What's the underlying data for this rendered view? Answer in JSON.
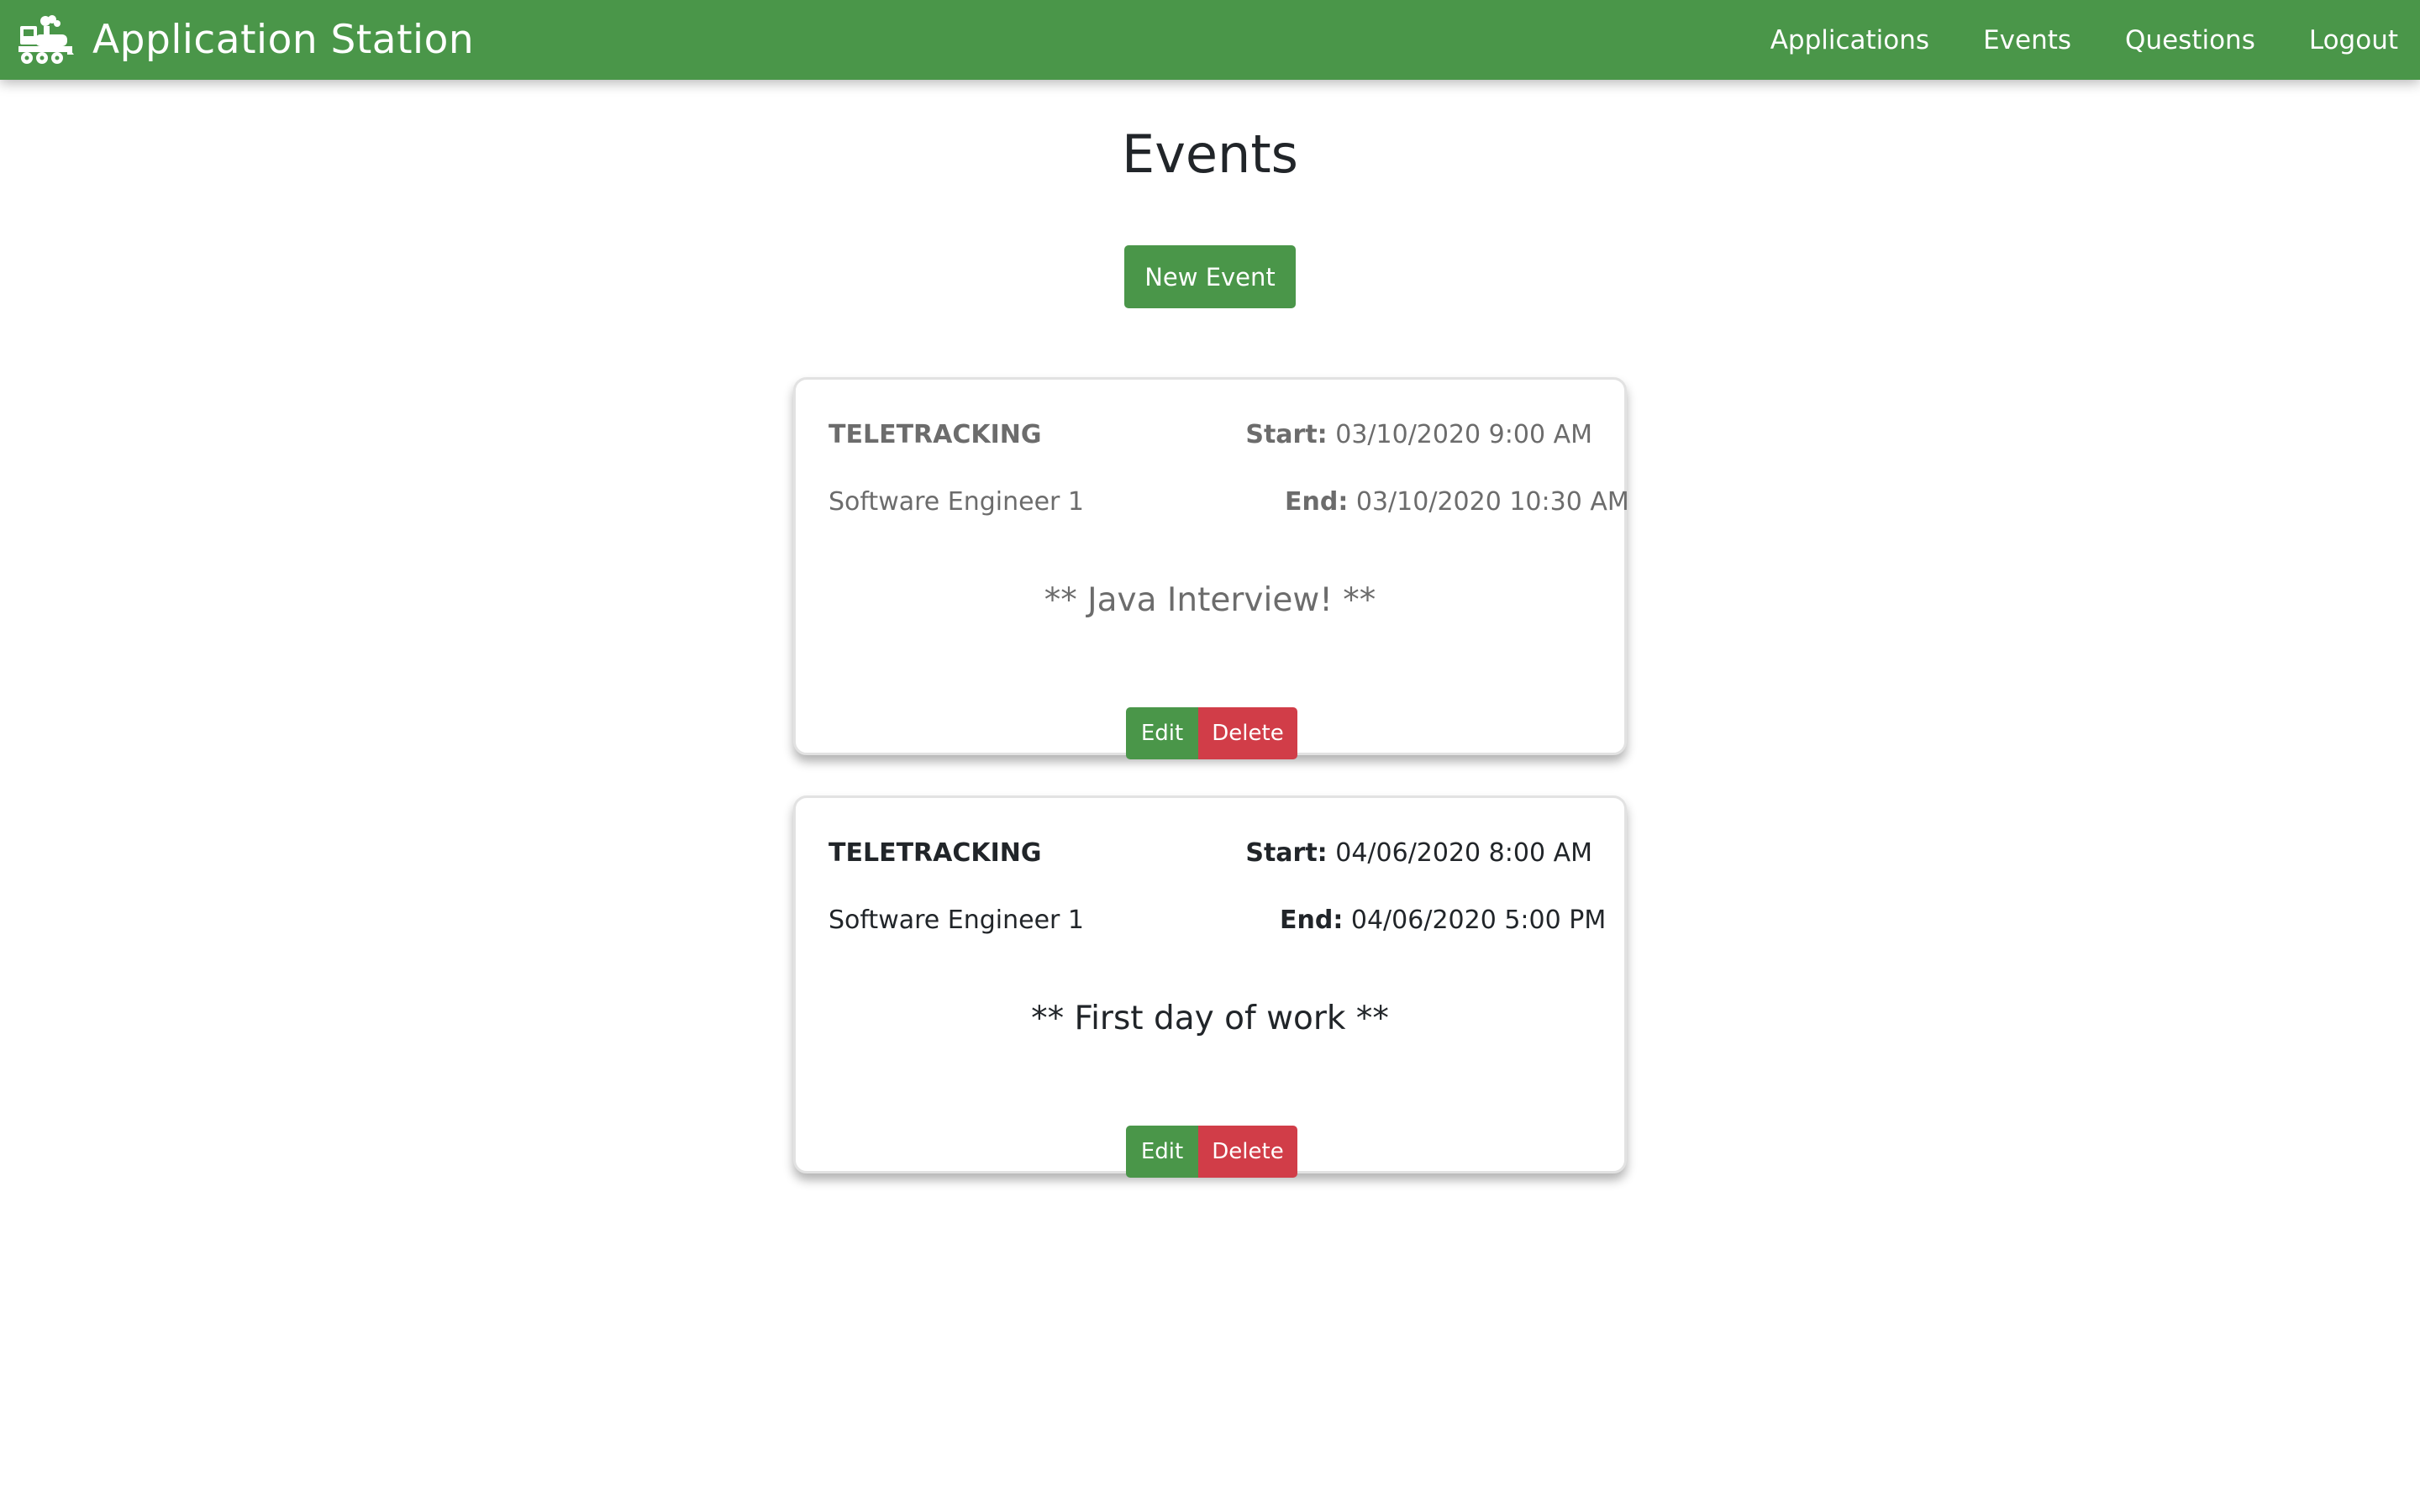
{
  "app": {
    "title": "Application Station",
    "brand_icon": "train-icon",
    "accent_color": "#4a9649",
    "danger_color": "#d13d48"
  },
  "nav": {
    "items": [
      "Applications",
      "Events",
      "Questions",
      "Logout"
    ]
  },
  "page": {
    "title": "Events",
    "new_event_label": "New Event"
  },
  "events": [
    {
      "company": "TELETRACKING",
      "position": "Software Engineer 1",
      "start_label": "Start:",
      "start": "03/10/2020 9:00 AM",
      "end_label": "End:",
      "end": "03/10/2020 10:30 AM",
      "description": "** Java Interview! **",
      "edit_label": "Edit",
      "delete_label": "Delete"
    },
    {
      "company": "TELETRACKING",
      "position": "Software Engineer 1",
      "start_label": "Start:",
      "start": "04/06/2020 8:00 AM",
      "end_label": "End:",
      "end": "04/06/2020 5:00 PM",
      "description": "** First day of work **",
      "edit_label": "Edit",
      "delete_label": "Delete"
    }
  ]
}
